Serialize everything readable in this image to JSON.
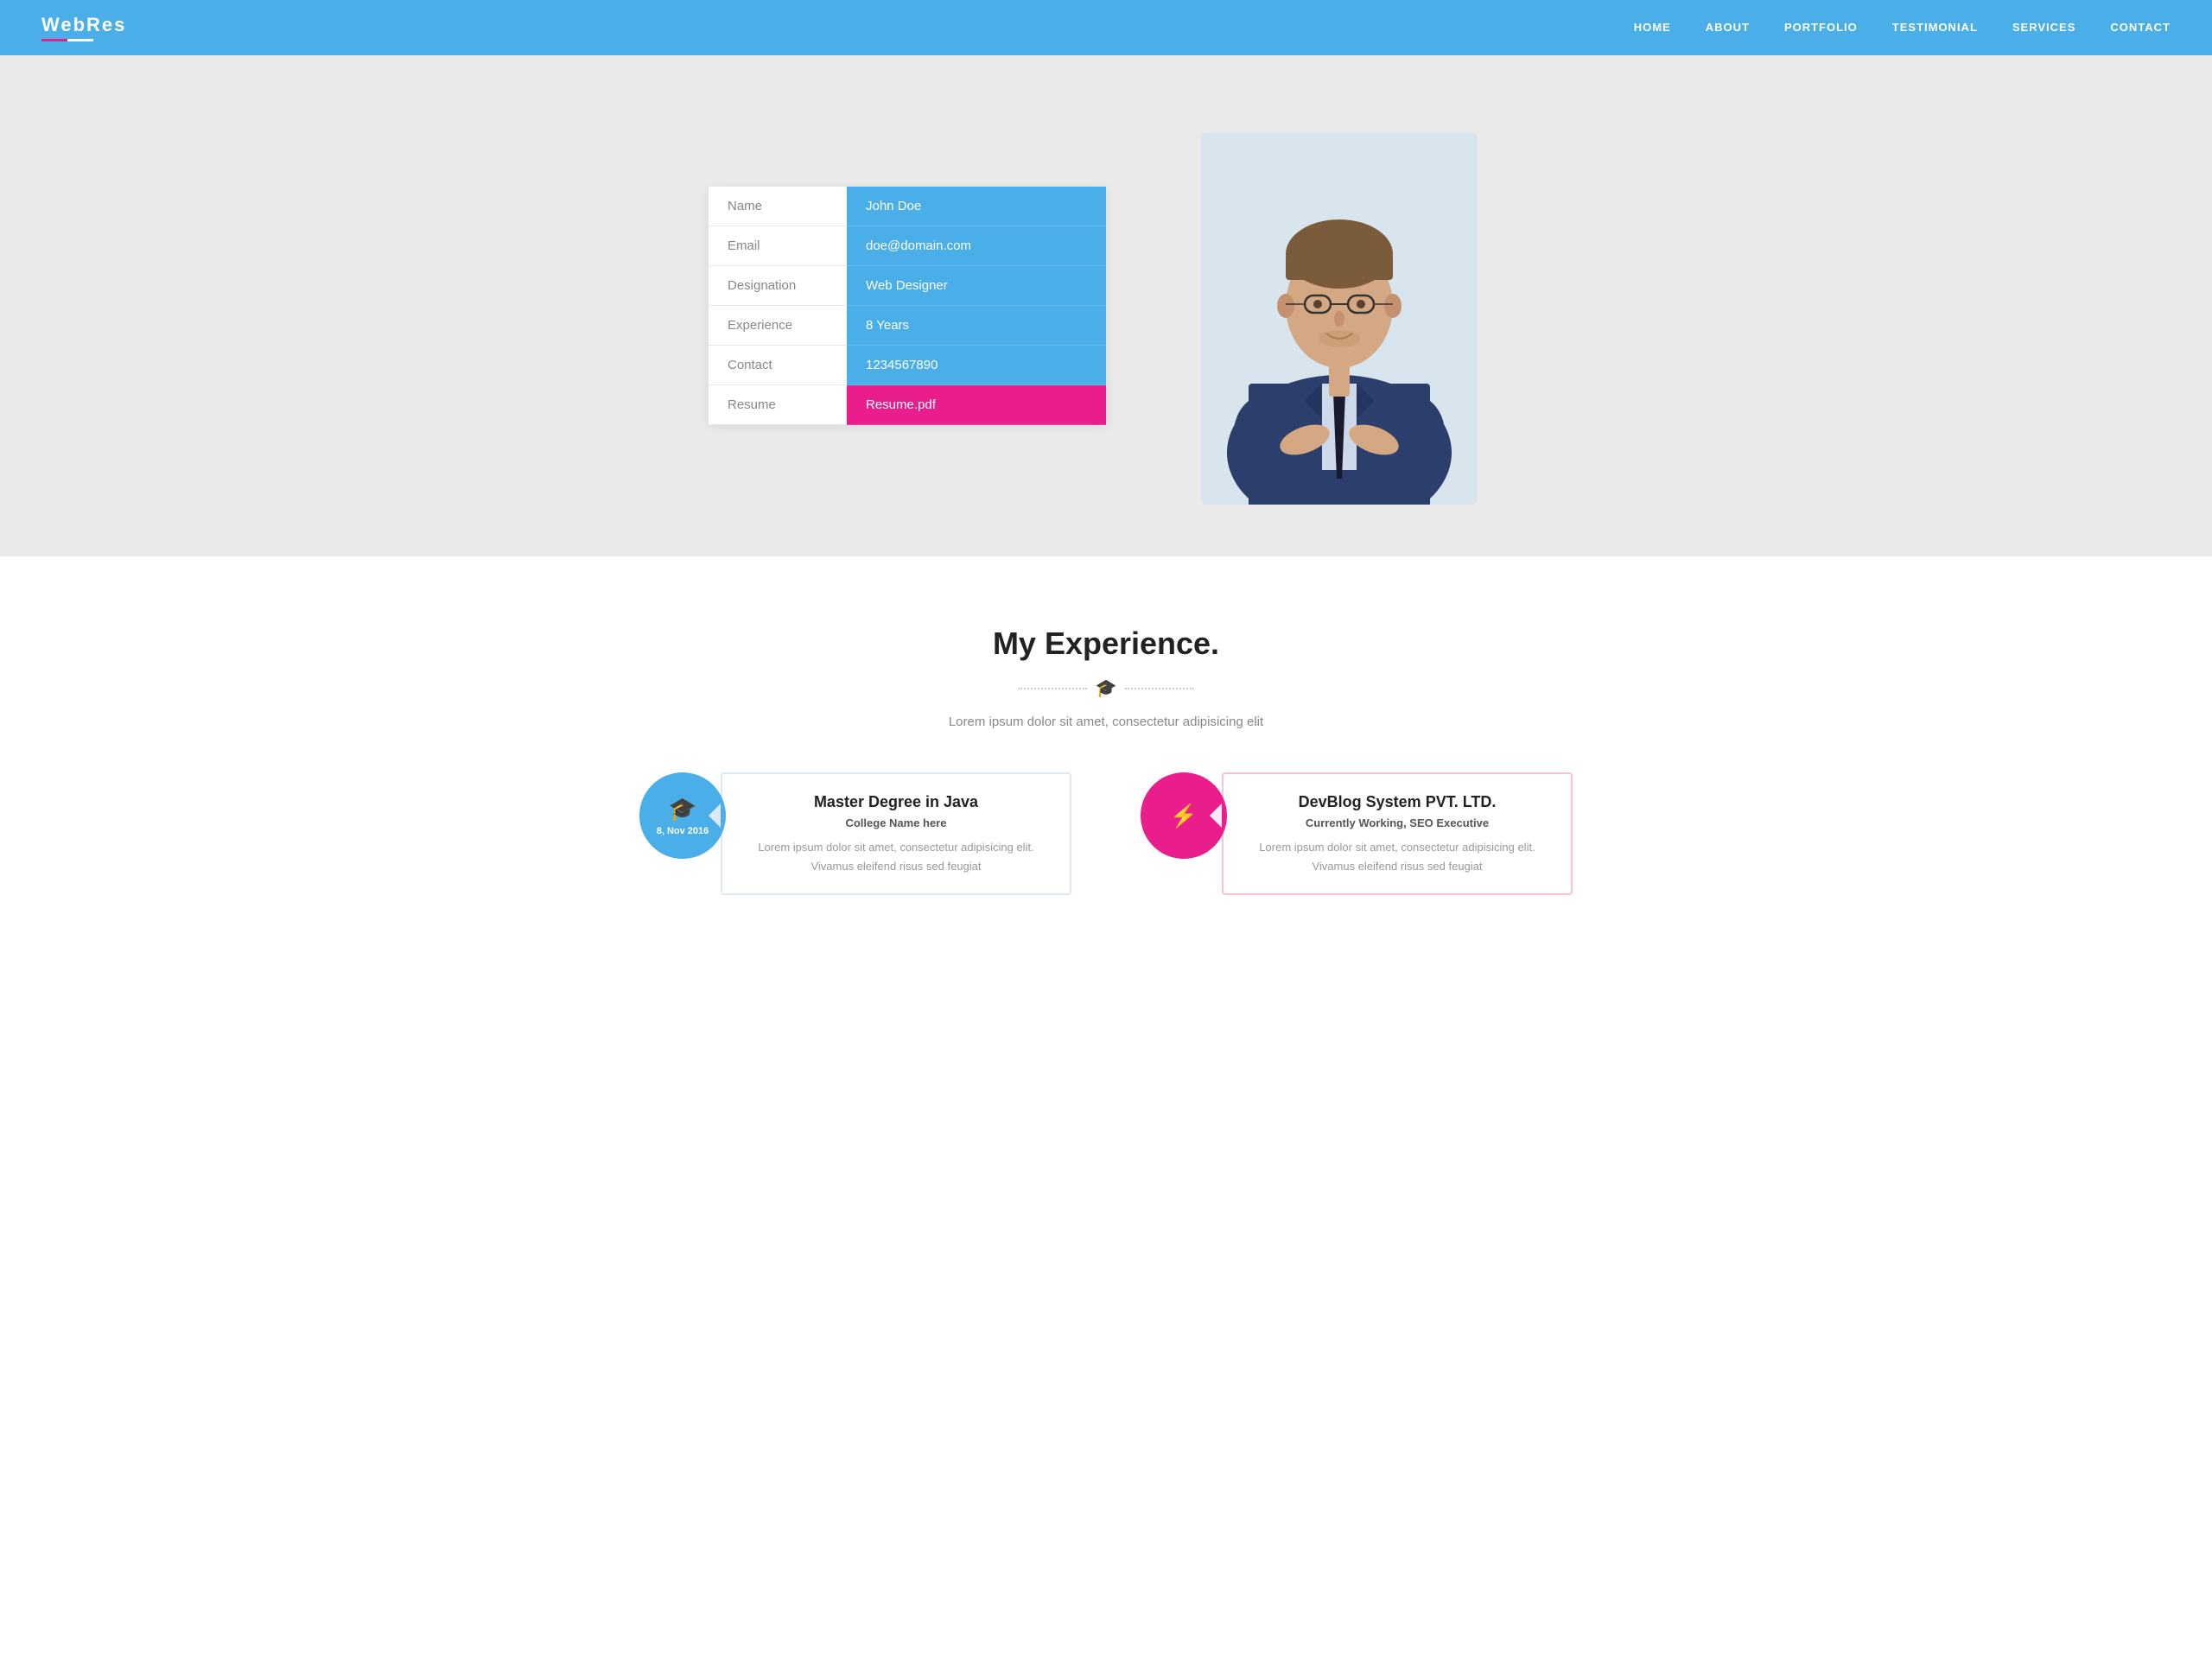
{
  "nav": {
    "logo": "WebRes",
    "links": [
      "HOME",
      "ABOUT",
      "PORTFOLIO",
      "TESTIMONIAL",
      "SERVICES",
      "CONTACT"
    ]
  },
  "hero": {
    "table": {
      "rows": [
        {
          "label": "Name",
          "value": "John Doe"
        },
        {
          "label": "Email",
          "value": "doe@domain.com"
        },
        {
          "label": "Designation",
          "value": "Web Designer"
        },
        {
          "label": "Experience",
          "value": "8 Years"
        },
        {
          "label": "Contact",
          "value": "1234567890"
        },
        {
          "label": "Resume",
          "value": "Resume.pdf"
        }
      ]
    }
  },
  "experience": {
    "title": "My Experience.",
    "subtitle": "Lorem ipsum dolor sit amet, consectetur adipisicing elit",
    "divider_icon": "🎓",
    "cards": [
      {
        "type": "education",
        "color": "blue",
        "icon": "🎓",
        "date": "8, Nov 2016",
        "title": "Master Degree in Java",
        "subtitle": "College Name here",
        "description": "Lorem ipsum dolor sit amet, consectetur adipisicing elit. Vivamus eleifend risus sed feugiat"
      },
      {
        "type": "work",
        "color": "pink",
        "icon": "⚡",
        "date": "",
        "title": "DevBlog System PVT. LTD.",
        "subtitle": "Currently Working, SEO Executive",
        "description": "Lorem ipsum dolor sit amet, consectetur adipisicing elit. Vivamus eleifend risus sed feugiat"
      }
    ]
  }
}
